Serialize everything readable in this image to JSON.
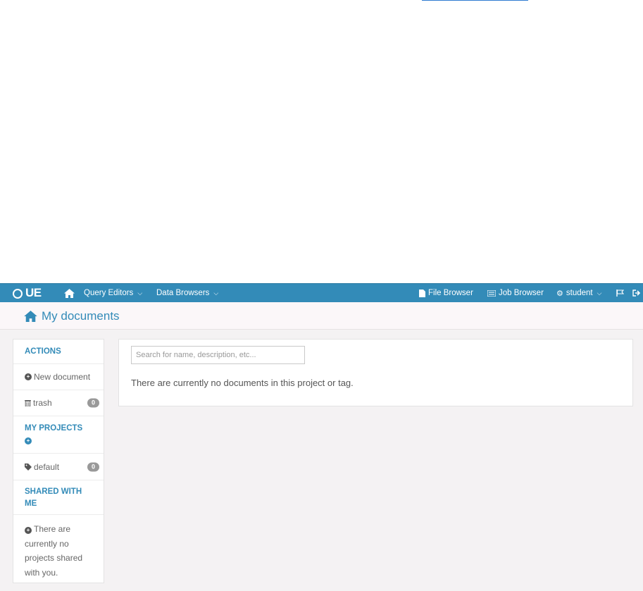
{
  "navbar": {
    "logo": "UE",
    "items": [
      {
        "label": "Query Editors"
      },
      {
        "label": "Data Browsers"
      }
    ],
    "right": [
      {
        "label": "File Browser"
      },
      {
        "label": "Job Browser"
      },
      {
        "label": "student"
      }
    ]
  },
  "page": {
    "title": "My documents"
  },
  "sidebar": {
    "actions_header": "ACTIONS",
    "new_document": "New document",
    "trash": {
      "label": "trash",
      "count": "0"
    },
    "projects_header": "MY PROJECTS",
    "default_project": {
      "label": "default",
      "count": "0"
    },
    "shared_header": "SHARED WITH ME",
    "shared_empty": "There are currently no projects shared with you."
  },
  "main": {
    "search_placeholder": "Search for name, description, etc...",
    "empty_message": "There are currently no documents in this project or tag."
  },
  "colors": {
    "navbar": "#338bb8",
    "accent": "#338bb8",
    "content_bg": "#f4f2f3"
  }
}
